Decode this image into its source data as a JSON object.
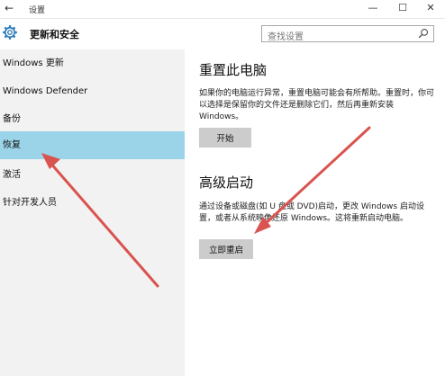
{
  "window": {
    "title": "设置",
    "back_glyph": "←",
    "min_glyph": "—",
    "max_glyph": "☐",
    "close_glyph": "✕"
  },
  "header": {
    "section_title": "更新和安全",
    "search_placeholder": "查找设置"
  },
  "sidebar": {
    "items": [
      {
        "label": "Windows 更新"
      },
      {
        "label": "Windows Defender"
      },
      {
        "label": "备份"
      },
      {
        "label": "恢复"
      },
      {
        "label": "激活"
      },
      {
        "label": "针对开发人员"
      }
    ],
    "selected_index": 3
  },
  "reset": {
    "heading": "重置此电脑",
    "description": "如果你的电脑运行异常，重置电脑可能会有所帮助。重置时，你可以选择是保留你的文件还是删除它们，然后再重新安装 Windows。",
    "button": "开始"
  },
  "advanced": {
    "heading": "高级启动",
    "description": "通过设备或磁盘(如 U 盘或 DVD)启动，更改 Windows 启动设置，或者从系统映像还原 Windows。这将重新启动电脑。",
    "button": "立即重启"
  },
  "colors": {
    "selected_bg": "#9bd4e8",
    "sidebar_bg": "#f2f2f2",
    "button_bg": "#cccccc",
    "arrow": "#d9534f"
  },
  "icons": {
    "gear": "gear-icon",
    "search": "search-icon",
    "arrow": "red-arrow-annotation"
  }
}
